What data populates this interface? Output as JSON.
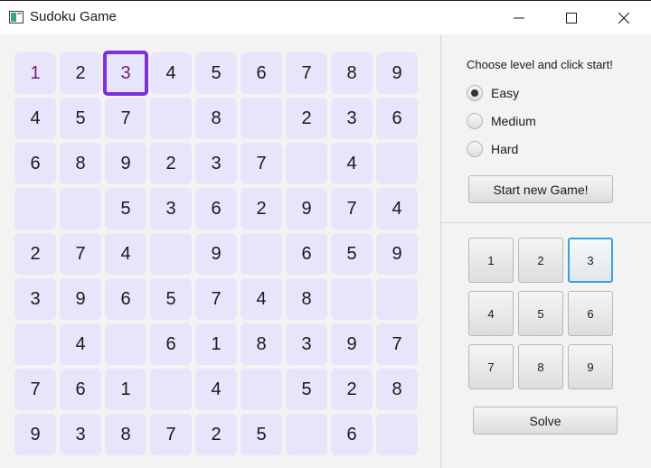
{
  "window": {
    "title": "Sudoku Game",
    "controls": {
      "minimize_icon": "minimize-icon",
      "maximize_icon": "maximize-icon",
      "close_icon": "close-icon"
    }
  },
  "colors": {
    "cell_bg": "#e6e5fb",
    "given_text": "#1a1a1a",
    "user_text": "#7b1a6e",
    "selected_border": "#7b2fe0",
    "active_number_border": "#3aa0e0"
  },
  "board": {
    "selected_cell": {
      "row": 0,
      "col": 2
    },
    "user_cells": [
      [
        0,
        0
      ],
      [
        0,
        2
      ]
    ],
    "rows": [
      [
        "1",
        "2",
        "3",
        "4",
        "5",
        "6",
        "7",
        "8",
        "9"
      ],
      [
        "4",
        "5",
        "7",
        "",
        "8",
        "",
        "2",
        "3",
        "6"
      ],
      [
        "6",
        "8",
        "9",
        "2",
        "3",
        "7",
        "",
        "4",
        ""
      ],
      [
        "",
        "",
        "5",
        "3",
        "6",
        "2",
        "9",
        "7",
        "4"
      ],
      [
        "2",
        "7",
        "4",
        "",
        "9",
        "",
        "6",
        "5",
        "9"
      ],
      [
        "3",
        "9",
        "6",
        "5",
        "7",
        "4",
        "8",
        "",
        ""
      ],
      [
        "",
        "4",
        "",
        "6",
        "1",
        "8",
        "3",
        "9",
        "7"
      ],
      [
        "7",
        "6",
        "1",
        "",
        "4",
        "",
        "5",
        "2",
        "8"
      ],
      [
        "9",
        "3",
        "8",
        "7",
        "2",
        "5",
        "",
        "6",
        ""
      ]
    ]
  },
  "controls": {
    "choose_label": "Choose level and click start!",
    "levels": [
      {
        "label": "Easy",
        "selected": true
      },
      {
        "label": "Medium",
        "selected": false
      },
      {
        "label": "Hard",
        "selected": false
      }
    ],
    "start_button": "Start new Game!",
    "number_pad": [
      "1",
      "2",
      "3",
      "4",
      "5",
      "6",
      "7",
      "8",
      "9"
    ],
    "active_number": "3",
    "solve_button": "Solve"
  }
}
